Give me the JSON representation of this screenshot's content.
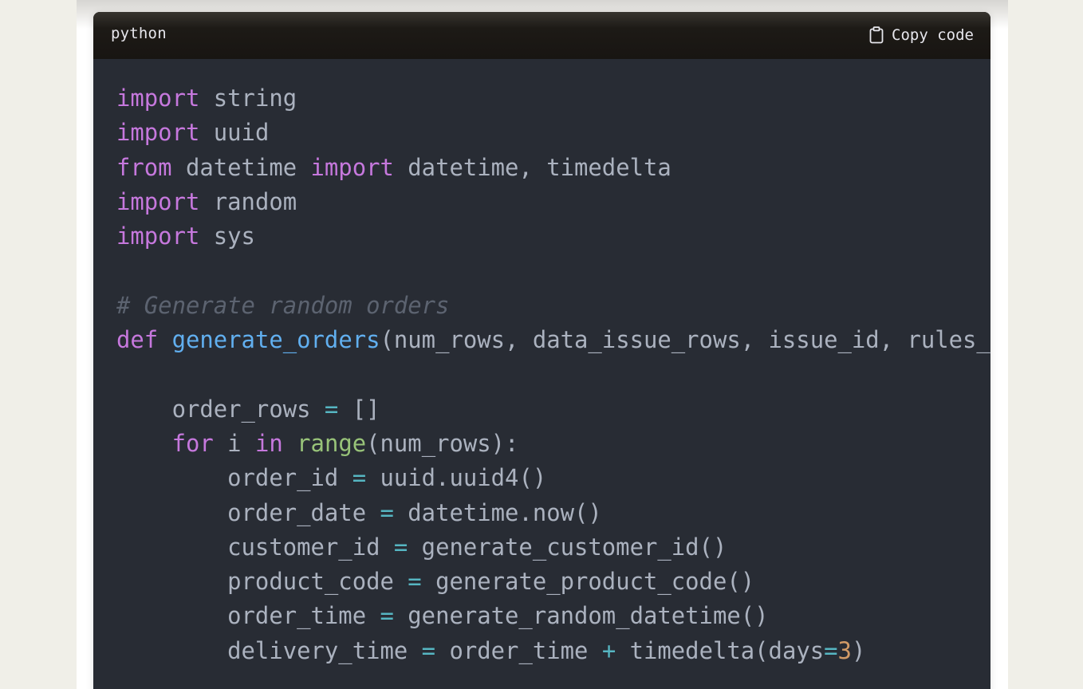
{
  "code_block": {
    "language": "python",
    "copy_label": "Copy code",
    "copy_icon": "clipboard-icon",
    "colors": {
      "background": "#282c34",
      "header_background": "#1d1a16",
      "keyword": "#c678dd",
      "function": "#61afef",
      "operator": "#56b6c2",
      "builtin": "#98c379",
      "number": "#d19a66",
      "comment": "#5c6370",
      "text": "#abb2bf"
    },
    "lines": [
      [
        [
          "kw",
          "import"
        ],
        [
          "tx",
          " string"
        ]
      ],
      [
        [
          "kw",
          "import"
        ],
        [
          "tx",
          " uuid"
        ]
      ],
      [
        [
          "kw",
          "from"
        ],
        [
          "tx",
          " datetime "
        ],
        [
          "kw",
          "import"
        ],
        [
          "tx",
          " datetime, timedelta"
        ]
      ],
      [
        [
          "kw",
          "import"
        ],
        [
          "tx",
          " random"
        ]
      ],
      [
        [
          "kw",
          "import"
        ],
        [
          "tx",
          " sys"
        ]
      ],
      [],
      [
        [
          "cm",
          "# Generate random orders"
        ]
      ],
      [
        [
          "kw",
          "def"
        ],
        [
          "tx",
          " "
        ],
        [
          "fn",
          "generate_orders"
        ],
        [
          "tx",
          "(num_rows, data_issue_rows, issue_id, rules_"
        ]
      ],
      [],
      [
        [
          "tx",
          "    order_rows "
        ],
        [
          "op",
          "="
        ],
        [
          "tx",
          " []"
        ]
      ],
      [
        [
          "tx",
          "    "
        ],
        [
          "kw",
          "for"
        ],
        [
          "tx",
          " i "
        ],
        [
          "kw",
          "in"
        ],
        [
          "tx",
          " "
        ],
        [
          "bi",
          "range"
        ],
        [
          "tx",
          "(num_rows):"
        ]
      ],
      [
        [
          "tx",
          "        order_id "
        ],
        [
          "op",
          "="
        ],
        [
          "tx",
          " uuid.uuid4()"
        ]
      ],
      [
        [
          "tx",
          "        order_date "
        ],
        [
          "op",
          "="
        ],
        [
          "tx",
          " datetime.now()"
        ]
      ],
      [
        [
          "tx",
          "        customer_id "
        ],
        [
          "op",
          "="
        ],
        [
          "tx",
          " generate_customer_id()"
        ]
      ],
      [
        [
          "tx",
          "        product_code "
        ],
        [
          "op",
          "="
        ],
        [
          "tx",
          " generate_product_code()"
        ]
      ],
      [
        [
          "tx",
          "        order_time "
        ],
        [
          "op",
          "="
        ],
        [
          "tx",
          " generate_random_datetime()"
        ]
      ],
      [
        [
          "tx",
          "        delivery_time "
        ],
        [
          "op",
          "="
        ],
        [
          "tx",
          " order_time "
        ],
        [
          "op",
          "+"
        ],
        [
          "tx",
          " timedelta(days"
        ],
        [
          "op",
          "="
        ],
        [
          "num",
          "3"
        ],
        [
          "tx",
          ")"
        ]
      ]
    ]
  }
}
